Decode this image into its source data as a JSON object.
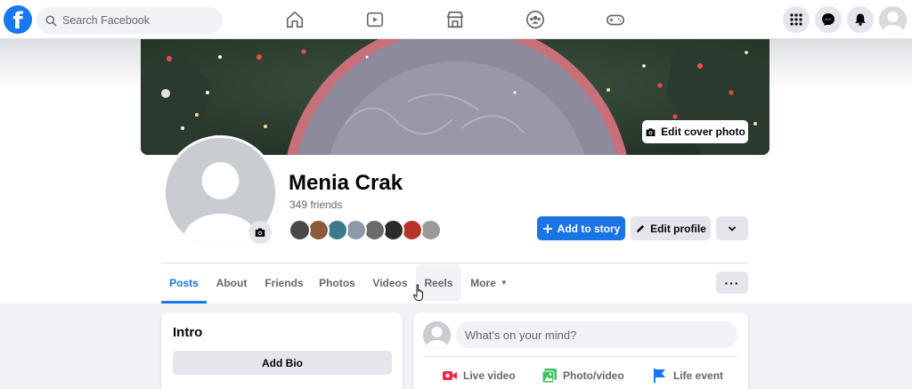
{
  "topbar": {
    "logo_letter": "f",
    "search_placeholder": "Search Facebook",
    "nav_icons": [
      "home-icon",
      "watch-icon",
      "marketplace-icon",
      "groups-icon",
      "gaming-icon"
    ],
    "right_icons": [
      "menu-grid-icon",
      "messenger-icon",
      "notifications-icon",
      "account-avatar"
    ]
  },
  "cover": {
    "edit_label": "Edit cover photo"
  },
  "profile": {
    "name": "Menia Crak",
    "friends_count": "349 friends",
    "friend_avatar_colors": [
      "#4a4a48",
      "#8a5a3a",
      "#3a7a8a",
      "#8a9aa8",
      "#6a6a6a",
      "#2a2a2a",
      "#b8322c",
      "#9a9a9a"
    ]
  },
  "actions": {
    "add_story": "Add to story",
    "edit_profile": "Edit profile",
    "dropdown_icon": "chevron-down-icon"
  },
  "tabs": [
    {
      "label": "Posts",
      "active": true
    },
    {
      "label": "About"
    },
    {
      "label": "Friends"
    },
    {
      "label": "Photos"
    },
    {
      "label": "Videos"
    },
    {
      "label": "Reels"
    },
    {
      "label": "More"
    }
  ],
  "more_options": "···",
  "intro": {
    "title": "Intro",
    "add_bio": "Add Bio"
  },
  "composer": {
    "placeholder": "What's on your mind?",
    "live_video": "Live video",
    "photo_video": "Photo/video",
    "life_event": "Life event"
  },
  "colors": {
    "brand_blue": "#1877f2",
    "button_gray": "#e4e6eb",
    "page_bg": "#f0f2f5",
    "text_secondary": "#65676b",
    "live_red": "#f02849",
    "photo_green": "#45bd62",
    "event_blue": "#1877f2"
  }
}
